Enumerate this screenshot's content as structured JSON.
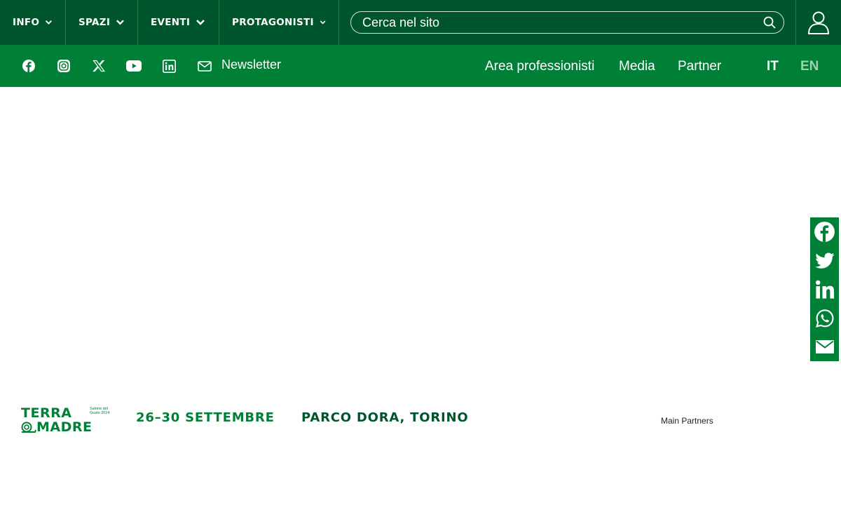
{
  "nav": {
    "items": [
      {
        "label": "INFO"
      },
      {
        "label": "SPAZI"
      },
      {
        "label": "EVENTI"
      },
      {
        "label": "PROTAGONISTI"
      }
    ],
    "search_placeholder": "Cerca nel sito"
  },
  "subbar": {
    "social_icons": [
      "facebook-icon",
      "instagram-icon",
      "x-icon",
      "youtube-icon",
      "linkedin-icon"
    ],
    "newsletter_label": "Newsletter",
    "links": [
      "Area professionisti",
      "Media",
      "Partner"
    ],
    "languages": [
      {
        "label": "IT",
        "active": true
      },
      {
        "label": "EN",
        "active": false
      }
    ]
  },
  "share": [
    "facebook-icon",
    "twitter-icon",
    "linkedin-icon",
    "whatsapp-icon",
    "email-icon"
  ],
  "footer": {
    "logo_line1": "TERRA",
    "logo_line2": "MADRE",
    "logo_tag": "Salone del Gusto 2024",
    "dates": "26–30 SETTEMBRE",
    "place": "PARCO DORA, TORINO",
    "partners_label": "Main Partners"
  },
  "colors": {
    "dark_green": "#00562c",
    "green": "#008037",
    "inactive_lang": "#9fd1b0"
  }
}
